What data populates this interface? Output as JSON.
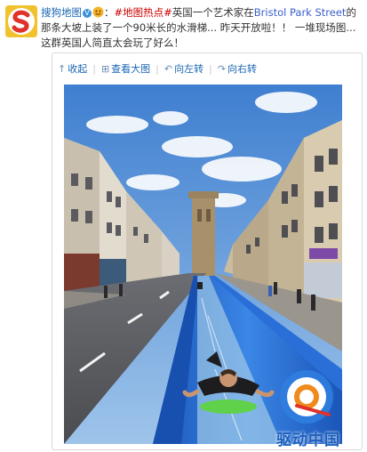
{
  "post": {
    "user_name": "搜狗地图",
    "verified_mark": "V",
    "colon": "：",
    "hashtag": "#地图热点#",
    "text_1": "英国一个艺术家在",
    "place": "Bristol Park Street",
    "text_2": "的那条大坡上装了一个90米长的水滑梯... 昨天开放啦！！ 一堆现场图... 这群英国人简直太会玩了好么！"
  },
  "toolbar": {
    "collapse_label": "收起",
    "view_large_label": "查看大图",
    "rotate_left_label": "向左转",
    "rotate_right_label": "向右转"
  },
  "watermark": {
    "text": "驱动中国"
  },
  "colors": {
    "link": "#1a66b3",
    "hashtag": "#cc0000",
    "slide_blue": "#1f63c6",
    "watermark_blue": "#1b5fbd"
  },
  "icons": [
    "sogou-logo-icon",
    "collapse-arrow-icon",
    "zoom-icon",
    "rotate-left-icon",
    "rotate-right-icon"
  ]
}
